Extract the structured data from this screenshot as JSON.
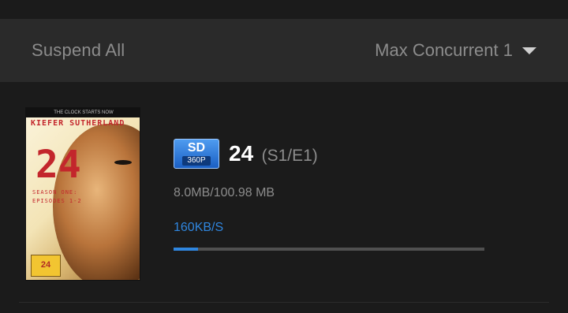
{
  "toolbar": {
    "suspend_all_label": "Suspend All",
    "max_concurrent_label": "Max Concurrent 1"
  },
  "download_item": {
    "poster": {
      "tagline": "THE CLOCK STARTS NOW",
      "actor": "KIEFER SUTHERLAND",
      "title_art": "24",
      "season_line1": "SEASON ONE:",
      "season_line2": "EPISODES 1-2",
      "badge_text": "24"
    },
    "quality_badge": {
      "label": "SD",
      "resolution": "360P"
    },
    "title": "24",
    "episode": "(S1/E1)",
    "size": "8.0MB/100.98 MB",
    "speed": "160KB/S",
    "progress_fraction": 0.079
  },
  "colors": {
    "accent": "#2f86df",
    "background": "#1b1b1b",
    "toolbar": "#2a2a2a"
  },
  "icons": {
    "dropdown": "caret-down-icon"
  }
}
